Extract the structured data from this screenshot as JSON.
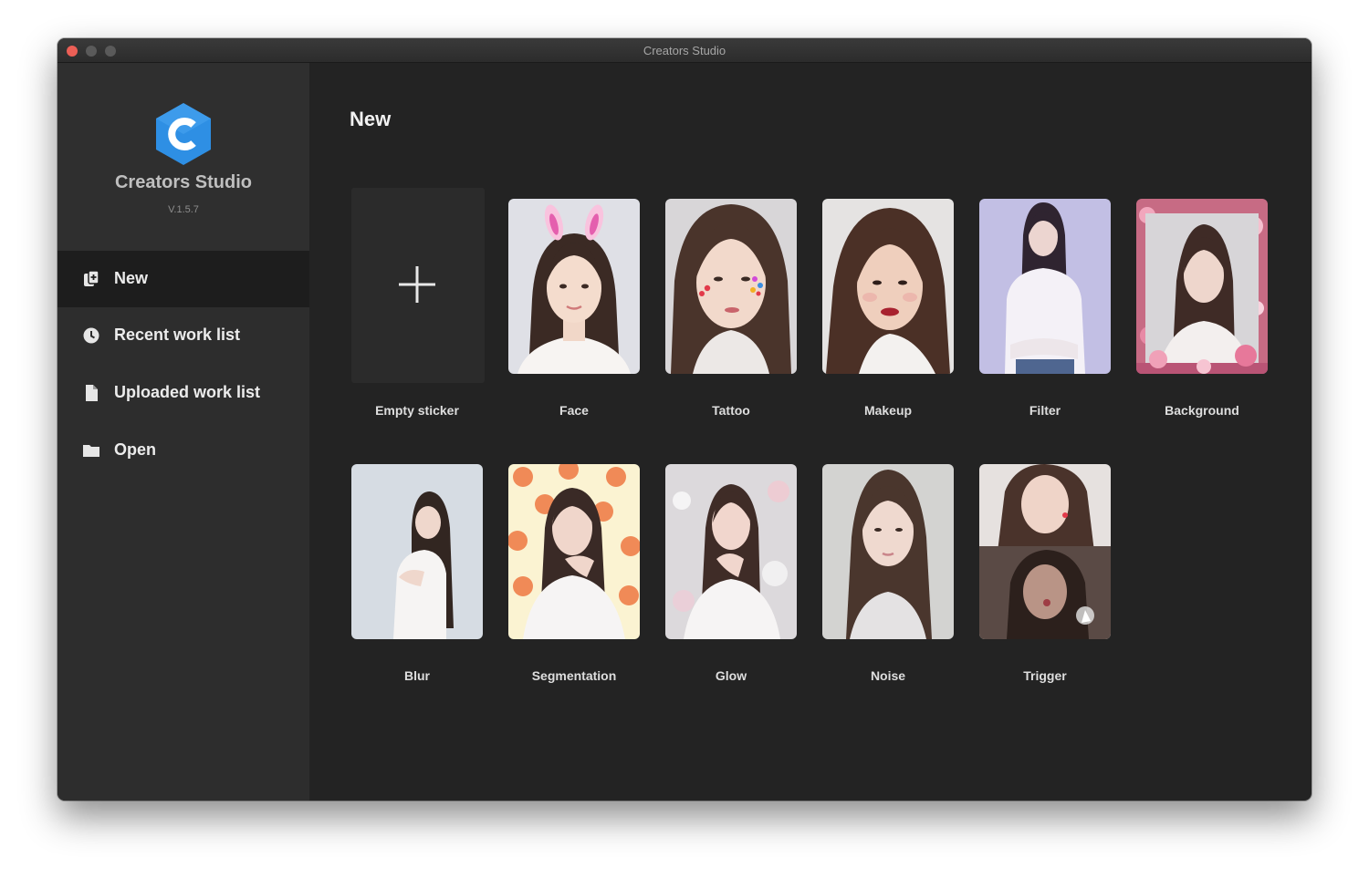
{
  "window": {
    "title": "Creators Studio"
  },
  "brand": {
    "name": "Creators Studio",
    "version": "V.1.5.7",
    "logo_icon": "hexagon-c-logo",
    "logo_color": "#2e8fe4"
  },
  "nav": [
    {
      "label": "New",
      "icon": "new-file-icon",
      "active": true
    },
    {
      "label": "Recent work list",
      "icon": "clock-icon",
      "active": false
    },
    {
      "label": "Uploaded work list",
      "icon": "document-icon",
      "active": false
    },
    {
      "label": "Open",
      "icon": "folder-icon",
      "active": false
    }
  ],
  "main": {
    "section_title": "New",
    "templates": [
      {
        "label": "Empty sticker",
        "kind": "plus-icon"
      },
      {
        "label": "Face"
      },
      {
        "label": "Tattoo"
      },
      {
        "label": "Makeup"
      },
      {
        "label": "Filter"
      },
      {
        "label": "Background"
      },
      {
        "label": "Blur"
      },
      {
        "label": "Segmentation"
      },
      {
        "label": "Glow"
      },
      {
        "label": "Noise"
      },
      {
        "label": "Trigger"
      }
    ]
  },
  "colors": {
    "sidebar_bg": "#2d2d2d",
    "main_bg": "#232323",
    "active_nav_bg": "#1d1d1d",
    "close_button": "#ec5f56"
  }
}
